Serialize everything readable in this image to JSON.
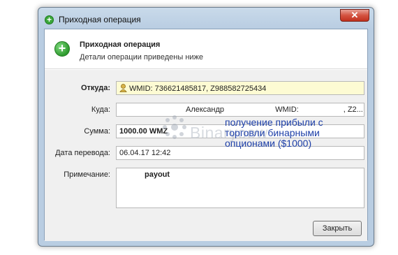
{
  "window": {
    "title": "Приходная операция",
    "close_glyph": "✕"
  },
  "header": {
    "title": "Приходная операция",
    "subtitle": "Детали операции приведены ниже",
    "icon": "plus-circle-icon"
  },
  "form": {
    "from_label": "Откуда:",
    "from_value": "WMID: 736621485817, Z988582725434",
    "to_label": "Куда:",
    "to_name": "Александр",
    "to_wmid_label": "WMID:",
    "to_suffix": ", Z2...",
    "amount_label": "Сумма:",
    "amount_value": "1000.00 WMZ",
    "date_label": "Дата перевода:",
    "date_value": "06.04.17 12:42",
    "note_label": "Примечание:",
    "note_value": "payout"
  },
  "buttons": {
    "close_label": "Закрыть"
  },
  "overlay": {
    "watermark": "Binaryoow",
    "caption": "получение прибыли с торговли бинарными опционами ($1000)"
  },
  "colors": {
    "accent_green": "#3aa73a",
    "overlay_text": "#1d3fa8",
    "highlight_field": "#fdfbd3"
  }
}
